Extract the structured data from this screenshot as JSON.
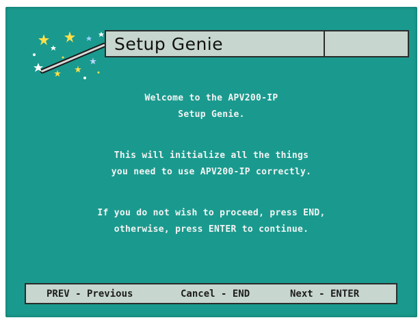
{
  "window": {
    "title": "Setup Genie"
  },
  "message": {
    "welcome_line1": "Welcome to the APV200-IP",
    "welcome_line2": "Setup Genie.",
    "init_line1": "This will initialize all the things",
    "init_line2": "you need to use APV200-IP correctly.",
    "proceed_line1": "If you do not wish to proceed, press END,",
    "proceed_line2": "otherwise, press ENTER to continue."
  },
  "footer": {
    "prev": "PREV - Previous",
    "cancel": "Cancel - END",
    "next": "Next - ENTER"
  },
  "colors": {
    "background": "#1a9a8e",
    "bar": "#c7d6cf",
    "text": "#f4f4f4"
  },
  "icons": {
    "logo": "magic-wand-stars-icon"
  }
}
